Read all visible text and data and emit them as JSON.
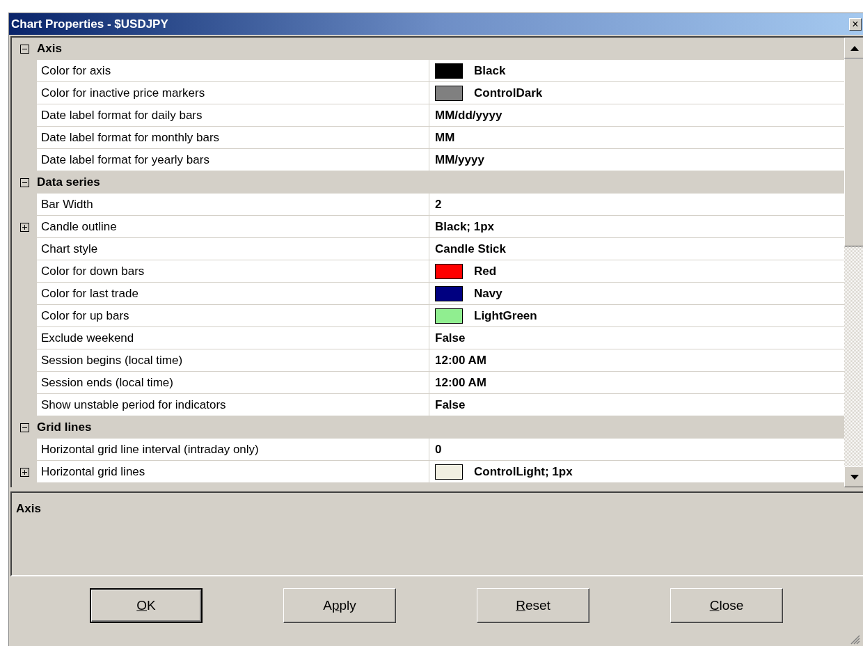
{
  "window": {
    "title": "Chart Properties - $USDJPY",
    "close": "×"
  },
  "categories": [
    {
      "label": "Axis",
      "expanded": true,
      "children": [
        {
          "name": "Color for axis",
          "value": "Black",
          "color": "#000000"
        },
        {
          "name": "Color for inactive price markers",
          "value": "ControlDark",
          "color": "#808080"
        },
        {
          "name": "Date label format for daily bars",
          "value": "MM/dd/yyyy"
        },
        {
          "name": "Date label format for monthly bars",
          "value": "MM"
        },
        {
          "name": "Date label format for yearly bars",
          "value": "MM/yyyy"
        }
      ]
    },
    {
      "label": "Data series",
      "expanded": true,
      "children": [
        {
          "name": "Bar Width",
          "value": "2"
        },
        {
          "name": "Candle outline",
          "value": "Black; 1px",
          "expanded": false
        },
        {
          "name": "Chart style",
          "value": "Candle Stick"
        },
        {
          "name": "Color for down bars",
          "value": "Red",
          "color": "#ff0000"
        },
        {
          "name": "Color for last trade",
          "value": "Navy",
          "color": "#000080"
        },
        {
          "name": "Color for up bars",
          "value": "LightGreen",
          "color": "#90ee90"
        },
        {
          "name": "Exclude weekend",
          "value": "False"
        },
        {
          "name": "Session begins (local time)",
          "value": "12:00 AM"
        },
        {
          "name": "Session ends (local time)",
          "value": "12:00 AM"
        },
        {
          "name": "Show unstable period for indicators",
          "value": "False"
        }
      ]
    },
    {
      "label": "Grid lines",
      "expanded": true,
      "children": [
        {
          "name": "Horizontal grid line interval (intraday only)",
          "value": "0"
        },
        {
          "name": "Horizontal grid lines",
          "value": "ControlLight; 1px",
          "expanded": false,
          "color": "#f1efe2"
        }
      ]
    }
  ],
  "description": {
    "title": "Axis"
  },
  "buttons": [
    {
      "key": "O",
      "after": "K",
      "default": true
    },
    {
      "before": "A",
      "key": "p",
      "after": "ply",
      "default": false
    },
    {
      "key": "R",
      "after": "eset",
      "default": false
    },
    {
      "key": "C",
      "after": "lose",
      "default": false
    }
  ]
}
